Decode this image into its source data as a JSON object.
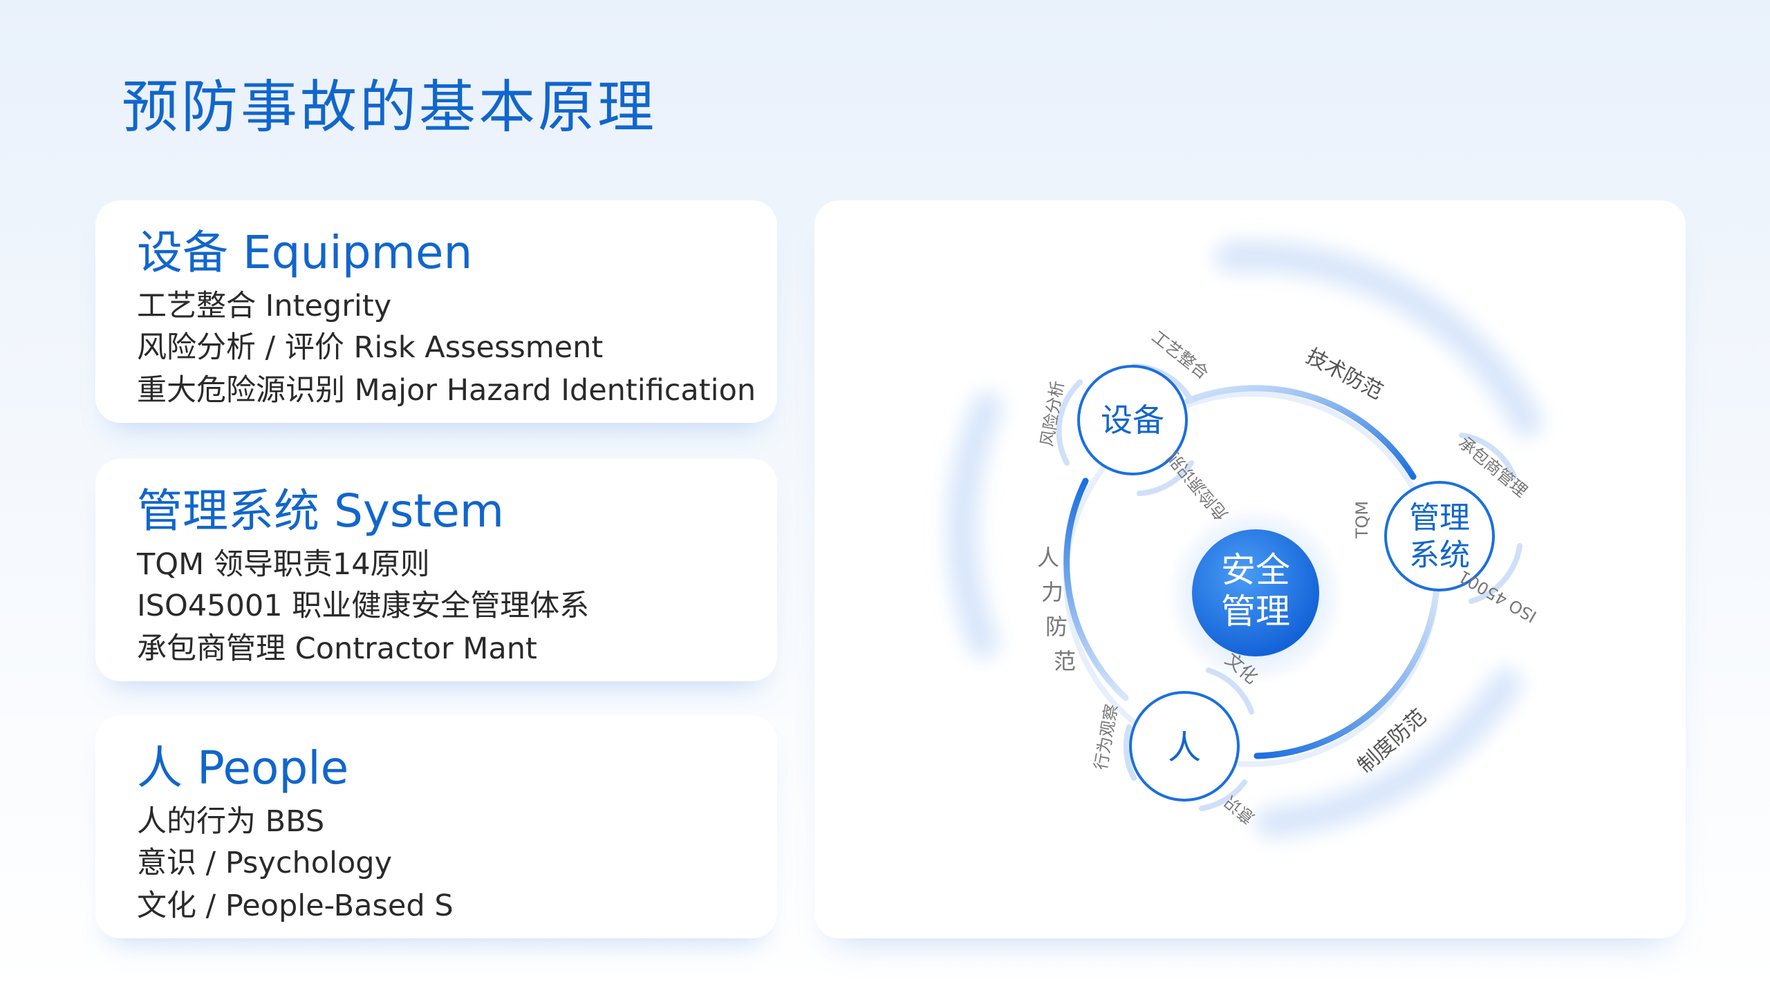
{
  "title": "预防事故的基本原理",
  "cards": [
    {
      "title": "设备 Equipmen",
      "lines": [
        "工艺整合 Integrity",
        "风险分析 / 评价 Risk Assessment",
        "重大危险源识别 Major Hazard Identification"
      ]
    },
    {
      "title": "管理系统 System",
      "lines": [
        "TQM 领导职责14原则",
        "ISO45001 职业健康安全管理体系",
        "承包商管理 Contractor Mant"
      ]
    },
    {
      "title": "人 People",
      "lines": [
        "人的行为 BBS",
        "意识 / Psychology",
        "文化 / People-Based S"
      ]
    }
  ],
  "diagram": {
    "center": [
      "安全",
      "管理"
    ],
    "nodes": {
      "equipment": "设备",
      "system": [
        "管理",
        "系统"
      ],
      "people": "人"
    },
    "arcs": {
      "tech": "技术防范",
      "institution": "制度防范",
      "human": [
        "人",
        "力",
        "防",
        "范"
      ]
    },
    "equipment_tags": [
      "工艺整合",
      "风险分析",
      "危险源识别"
    ],
    "system_tags": [
      "承包商管理",
      "TQM",
      "ISO 45001"
    ],
    "people_tags": [
      "文化",
      "行为观察",
      "意识"
    ],
    "colors": {
      "accent": "#1a6fe0",
      "title": "#1166cc",
      "ring": "#c8dcf7"
    }
  }
}
